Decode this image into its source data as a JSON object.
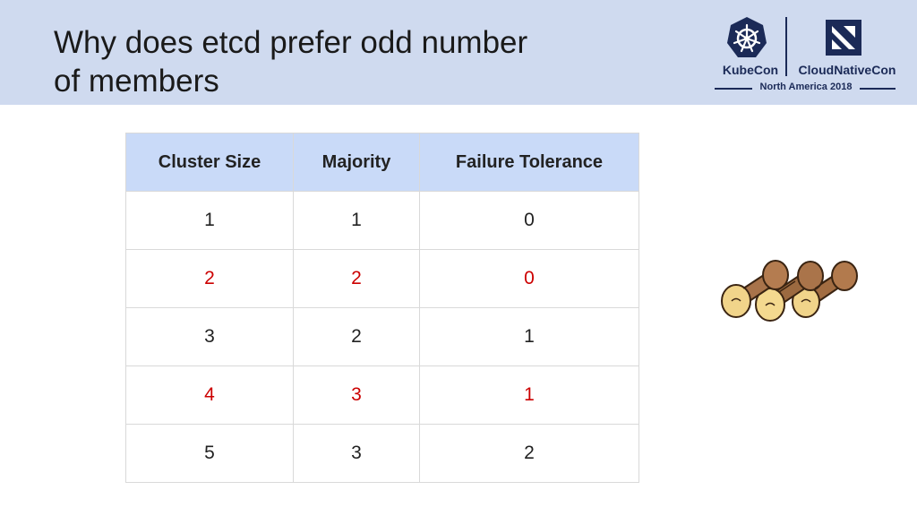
{
  "slide": {
    "title": "Why does etcd prefer odd number\nof members"
  },
  "branding": {
    "kubecon_label": "KubeCon",
    "cloudnativecon_label": "CloudNativeCon",
    "event_label": "North America 2018",
    "logo_color": "#1b2a57"
  },
  "table": {
    "headers": [
      "Cluster Size",
      "Majority",
      "Failure Tolerance"
    ],
    "rows": [
      {
        "cells": [
          "1",
          "1",
          "0"
        ],
        "highlight": false
      },
      {
        "cells": [
          "2",
          "2",
          "0"
        ],
        "highlight": true
      },
      {
        "cells": [
          "3",
          "2",
          "1"
        ],
        "highlight": false
      },
      {
        "cells": [
          "4",
          "3",
          "1"
        ],
        "highlight": true
      },
      {
        "cells": [
          "5",
          "3",
          "2"
        ],
        "highlight": false
      }
    ],
    "header_bg": "#c9daf8",
    "highlight_color": "#cc0000"
  },
  "illustration": {
    "icon": "wooden-logs-icon"
  }
}
